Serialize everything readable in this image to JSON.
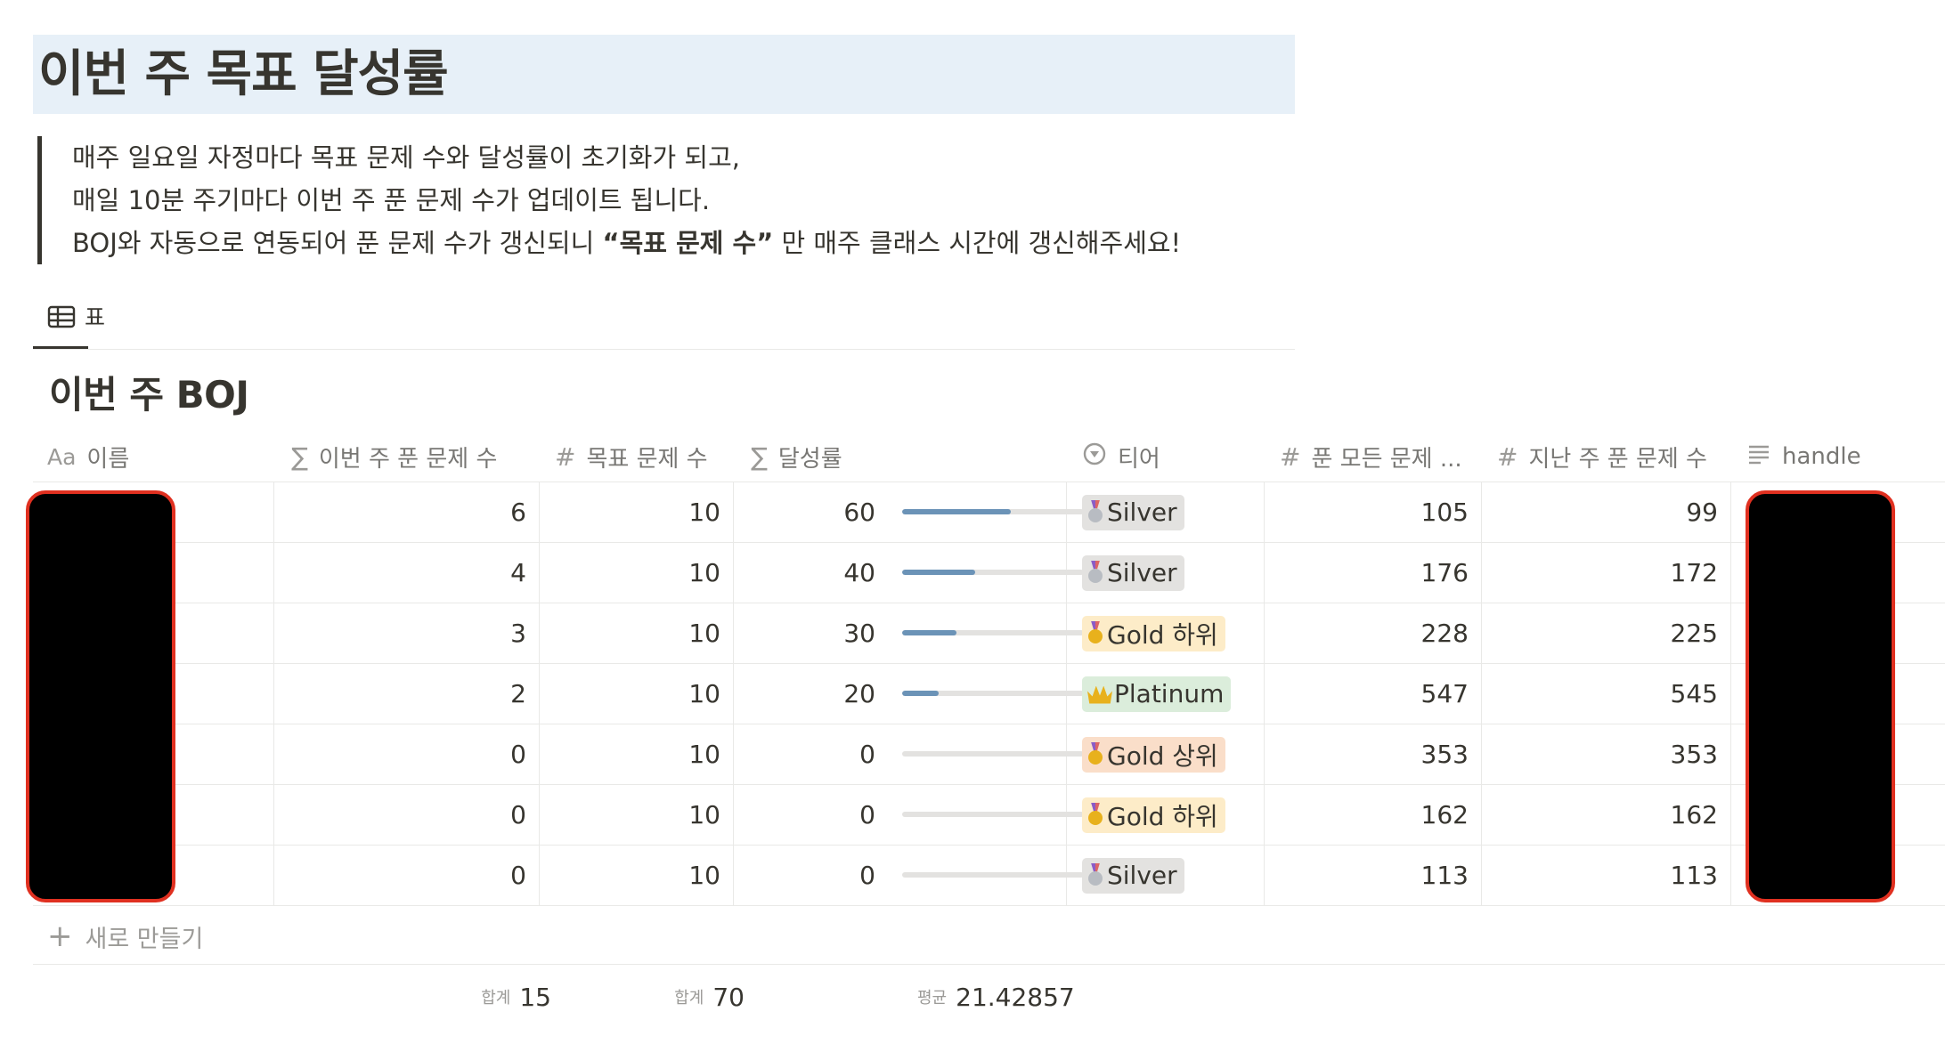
{
  "heading": "이번 주 목표 달성률",
  "quote": {
    "line1": "매주 일요일 자정마다 목표 문제 수와 달성률이 초기화가 되고,",
    "line2": "매일 10분 주기마다 이번 주 푼 문제 수가 업데이트 됩니다.",
    "line3_pre": "BOJ와 자동으로 연동되어 푼 문제 수가 갱신되니 ",
    "line3_bold": "“목표 문제 수”",
    "line3_post": " 만 매주 클래스 시간에 갱신해주세요!"
  },
  "view_tab": {
    "icon": "table-icon",
    "label": "표"
  },
  "table_title": "이번 주 BOJ",
  "columns": {
    "name": {
      "icon": "Aa",
      "label": "이름"
    },
    "solved_week": {
      "icon": "∑",
      "label": "이번 주 푼 문제 수"
    },
    "goal": {
      "icon": "#",
      "label": "목표 문제 수"
    },
    "rate": {
      "icon": "∑",
      "label": "달성률"
    },
    "tier": {
      "icon": "select-icon",
      "label": "티어"
    },
    "total": {
      "icon": "#",
      "label": "푼 모든 문제 ..."
    },
    "last_week": {
      "icon": "#",
      "label": "지난 주 푼 문제 수"
    },
    "handle": {
      "icon": "text-lines-icon",
      "label": "handle"
    }
  },
  "rows": [
    {
      "solved_week": "6",
      "goal": "10",
      "rate": "60",
      "rate_fraction": 0.6,
      "tier": "Silver",
      "tier_icon": "silver-medal-icon",
      "tier_color": "#e3e2e0",
      "total": "105",
      "last_week": "99"
    },
    {
      "solved_week": "4",
      "goal": "10",
      "rate": "40",
      "rate_fraction": 0.4,
      "tier": "Silver",
      "tier_icon": "silver-medal-icon",
      "tier_color": "#e3e2e0",
      "total": "176",
      "last_week": "172"
    },
    {
      "solved_week": "3",
      "goal": "10",
      "rate": "30",
      "rate_fraction": 0.3,
      "tier": "Gold 하위",
      "tier_icon": "gold-medal-icon",
      "tier_color": "#fdecc8",
      "total": "228",
      "last_week": "225"
    },
    {
      "solved_week": "2",
      "goal": "10",
      "rate": "20",
      "rate_fraction": 0.2,
      "tier": "Platinum",
      "tier_icon": "crown-icon",
      "tier_color": "#dbeddb",
      "total": "547",
      "last_week": "545"
    },
    {
      "solved_week": "0",
      "goal": "10",
      "rate": "0",
      "rate_fraction": 0,
      "tier": "Gold 상위",
      "tier_icon": "gold-medal-icon",
      "tier_color": "#fadec9",
      "total": "353",
      "last_week": "353"
    },
    {
      "solved_week": "0",
      "goal": "10",
      "rate": "0",
      "rate_fraction": 0,
      "tier": "Gold 하위",
      "tier_icon": "gold-medal-icon",
      "tier_color": "#fdecc8",
      "total": "162",
      "last_week": "162"
    },
    {
      "solved_week": "0",
      "goal": "10",
      "rate": "0",
      "rate_fraction": 0,
      "tier": "Silver",
      "tier_icon": "silver-medal-icon",
      "tier_color": "#e3e2e0",
      "total": "113",
      "last_week": "113"
    }
  ],
  "new_row_label": "새로 만들기",
  "footer": {
    "solved_week": {
      "label": "합계",
      "value": "15"
    },
    "goal": {
      "label": "합계",
      "value": "70"
    },
    "rate": {
      "label": "평균",
      "value": "21.42857"
    }
  },
  "colors": {
    "progress": "#6b93b7",
    "heading_bg": "#e7f0f8",
    "redaction_border": "#e03020"
  }
}
